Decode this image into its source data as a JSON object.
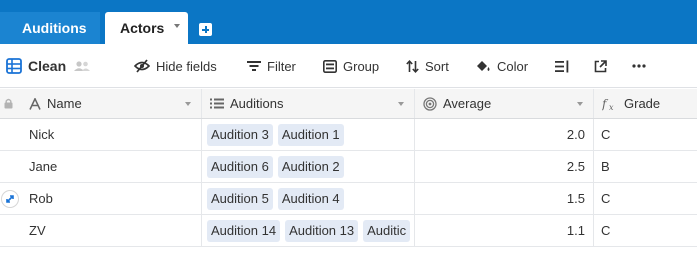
{
  "tabs": [
    {
      "label": "Auditions",
      "active": false
    },
    {
      "label": "Actors",
      "active": true
    }
  ],
  "toolbar": {
    "view_name": "Clean",
    "hide_fields": "Hide fields",
    "filter": "Filter",
    "group": "Group",
    "sort": "Sort",
    "color": "Color"
  },
  "columns": [
    {
      "label": "Name",
      "icon": "text-icon"
    },
    {
      "label": "Auditions",
      "icon": "linked-record-icon"
    },
    {
      "label": "Average",
      "icon": "rollup-icon"
    },
    {
      "label": "Grade",
      "icon": "formula-icon"
    }
  ],
  "rows": [
    {
      "name": "Nick",
      "auditions": [
        "Audition 3",
        "Audition 1"
      ],
      "average": "2.0",
      "grade": "C"
    },
    {
      "name": "Jane",
      "auditions": [
        "Audition 6",
        "Audition 2"
      ],
      "average": "2.5",
      "grade": "B"
    },
    {
      "name": "Rob",
      "auditions": [
        "Audition 5",
        "Audition 4"
      ],
      "average": "1.5",
      "grade": "C"
    },
    {
      "name": "ZV",
      "auditions": [
        "Audition 14",
        "Audition 13",
        "Auditic"
      ],
      "average": "1.1",
      "grade": "C"
    }
  ],
  "colors": {
    "brand": "#0b76c5",
    "chip": "#e3eaf5",
    "header_bg": "#f5f5f5"
  }
}
